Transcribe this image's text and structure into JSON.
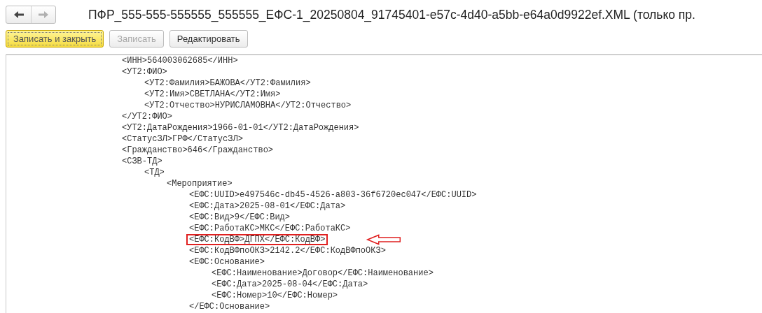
{
  "window": {
    "title": "ПФР_555-555-555555_555555_ЕФС-1_20250804_91745401-e57c-4d40-a5bb-e64a0d9922ef.XML (только пр."
  },
  "nav": {
    "back_disabled": false,
    "forward_disabled": true
  },
  "toolbar": [
    {
      "label": "Записать и закрыть",
      "kind": "default",
      "disabled": false
    },
    {
      "label": "Записать",
      "kind": "plain",
      "disabled": true
    },
    {
      "label": "Редактировать",
      "kind": "plain",
      "disabled": false
    }
  ],
  "xml_lines": [
    {
      "text": "<ИНН>564003062685</ИНН>"
    },
    {
      "text": "<УТ2:ФИО>",
      "children": [
        {
          "text": "<УТ2:Фамилия>БАЖОВА</УТ2:Фамилия>"
        },
        {
          "text": "<УТ2:Имя>СВЕТЛАНА</УТ2:Имя>"
        },
        {
          "text": "<УТ2:Отчество>НУРИСЛАМОВНА</УТ2:Отчество>"
        }
      ]
    },
    {
      "text": "</УТ2:ФИО>"
    },
    {
      "text": "<УТ2:ДатаРождения>1966-01-01</УТ2:ДатаРождения>"
    },
    {
      "text": "<СтатусЗЛ>ГРФ</СтатусЗЛ>"
    },
    {
      "text": "<Гражданство>646</Гражданство>"
    },
    {
      "text": "<СЗВ-ТД>",
      "children": [
        {
          "text": "<ТД>",
          "children": [
            {
              "text": "<Мероприятие>",
              "children": [
                {
                  "text": "<ЕФС:UUID>e497546c-db45-4526-a803-36f6720ec047</ЕФС:UUID>"
                },
                {
                  "text": "<ЕФС:Дата>2025-08-01</ЕФС:Дата>"
                },
                {
                  "text": "<ЕФС:Вид>9</ЕФС:Вид>"
                },
                {
                  "text": "<ЕФС:РаботаКС>МКС</ЕФС:РаботаКС>"
                },
                {
                  "text": "<ЕФС:КодВФ>ДГПХ</ЕФС:КодВФ>",
                  "highlighted": true
                },
                {
                  "text": "<ЕФС:КодВФпоОКЗ>2142.2</ЕФС:КодВФпоОКЗ>"
                },
                {
                  "text": "<ЕФС:Основание>",
                  "children": [
                    {
                      "text": "<ЕФС:Наименование>Договор</ЕФС:Наименование>"
                    },
                    {
                      "text": "<ЕФС:Дата>2025-08-04</ЕФС:Дата>"
                    },
                    {
                      "text": "<ЕФС:Номер>10</ЕФС:Номер>"
                    }
                  ]
                },
                {
                  "text": "</ЕФС:Основание>"
                }
              ]
            }
          ]
        }
      ]
    }
  ]
}
